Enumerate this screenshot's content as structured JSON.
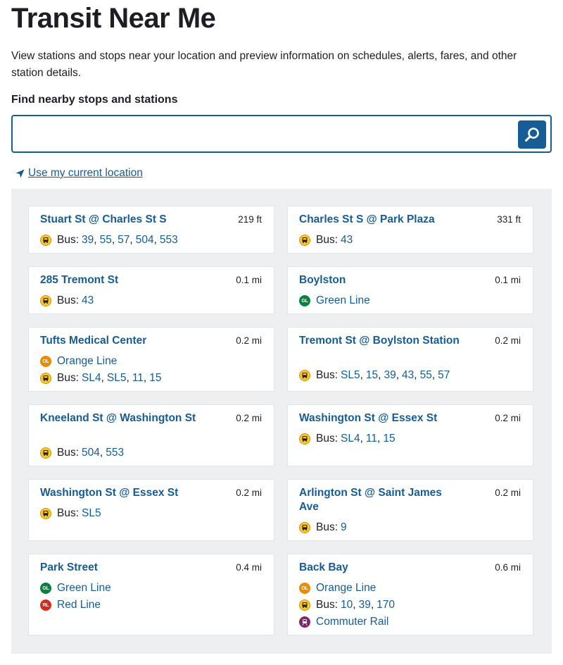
{
  "page": {
    "title": "Transit Near Me",
    "intro": "View stations and stops near your location and preview information on schedules, alerts, fares, and other station details.",
    "find_label": "Find nearby stops and stations",
    "search_value": "",
    "location_link": "Use my current location"
  },
  "colors": {
    "link": "#165c96",
    "green_line": "#00843d",
    "orange_line": "#ed8b00",
    "red_line": "#da291c",
    "bus": "#ffc72c",
    "commuter_rail": "#80276c",
    "panel_bg": "#eeeff1"
  },
  "stops": [
    {
      "name": "Stuart St @ Charles St S",
      "distance": "219 ft",
      "routes": [
        {
          "type": "bus",
          "label": "Bus:",
          "numbers": [
            "39",
            "55",
            "57",
            "504",
            "553"
          ]
        }
      ]
    },
    {
      "name": "Charles St S @ Park Plaza",
      "distance": "331 ft",
      "routes": [
        {
          "type": "bus",
          "label": "Bus:",
          "numbers": [
            "43"
          ]
        }
      ]
    },
    {
      "name": "285 Tremont St",
      "distance": "0.1 mi",
      "routes": [
        {
          "type": "bus",
          "label": "Bus:",
          "numbers": [
            "43"
          ]
        }
      ]
    },
    {
      "name": "Boylston",
      "distance": "0.1 mi",
      "routes": [
        {
          "type": "gl",
          "label": "Green Line",
          "icon_text": "GL"
        }
      ]
    },
    {
      "name": "Tufts Medical Center",
      "distance": "0.2 mi",
      "routes": [
        {
          "type": "ol",
          "label": "Orange Line",
          "icon_text": "OL"
        },
        {
          "type": "bus",
          "label": "Bus:",
          "numbers": [
            "SL4",
            "SL5",
            "11",
            "15"
          ]
        }
      ]
    },
    {
      "name": "Tremont St @ Boylston Station",
      "distance": "0.2 mi",
      "routes": [
        {
          "type": "bus",
          "label": "Bus:",
          "numbers": [
            "SL5",
            "15",
            "39",
            "43",
            "55",
            "57"
          ]
        }
      ]
    },
    {
      "name": "Kneeland St @ Washington St",
      "distance": "0.2 mi",
      "routes": [
        {
          "type": "bus",
          "label": "Bus:",
          "numbers": [
            "504",
            "553"
          ]
        }
      ]
    },
    {
      "name": "Washington St @ Essex St",
      "distance": "0.2 mi",
      "routes": [
        {
          "type": "bus",
          "label": "Bus:",
          "numbers": [
            "SL4",
            "11",
            "15"
          ]
        }
      ]
    },
    {
      "name": "Washington St @ Essex St",
      "distance": "0.2 mi",
      "routes": [
        {
          "type": "bus",
          "label": "Bus:",
          "numbers": [
            "SL5"
          ]
        }
      ]
    },
    {
      "name": "Arlington St @ Saint James Ave",
      "distance": "0.2 mi",
      "routes": [
        {
          "type": "bus",
          "label": "Bus:",
          "numbers": [
            "9"
          ]
        }
      ]
    },
    {
      "name": "Park Street",
      "distance": "0.4 mi",
      "routes": [
        {
          "type": "gl",
          "label": "Green Line",
          "icon_text": "GL"
        },
        {
          "type": "rl",
          "label": "Red Line",
          "icon_text": "RL"
        }
      ]
    },
    {
      "name": "Back Bay",
      "distance": "0.6 mi",
      "routes": [
        {
          "type": "ol",
          "label": "Orange Line",
          "icon_text": "OL"
        },
        {
          "type": "bus",
          "label": "Bus:",
          "numbers": [
            "10",
            "39",
            "170"
          ]
        },
        {
          "type": "cr",
          "label": "Commuter Rail"
        }
      ]
    }
  ]
}
